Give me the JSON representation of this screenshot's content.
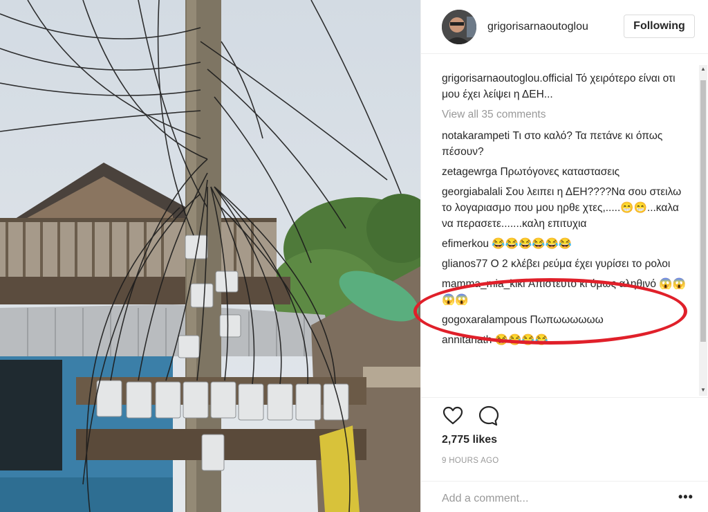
{
  "post": {
    "username": "grigorisarnaoutoglou",
    "follow_label": "Following",
    "view_all": "View all 35 comments",
    "likes": "2,775 likes",
    "time": "9 HOURS AGO",
    "add_comment_placeholder": "Add a comment...",
    "more_icon": "•••"
  },
  "comments": [
    {
      "user": "grigorisarnaoutoglou.official",
      "text": "Τό χειρότερο είναι οτι μου έχει λείψει η ΔΕΗ..."
    },
    {
      "user": "notakarampeti",
      "text": "Τι στο καλό? Τα πετάνε κι όπως πέσουν?"
    },
    {
      "user": "zetagewrga",
      "text": "Πρωτόγονες καταστασεις"
    },
    {
      "user": "georgiabalali",
      "text": "Σου λειπει η ΔΕΗ????Να σου στειλω το λογαριασμο που μου ηρθε χτες,.....😁😁...καλα να περασετε.......καλη επιτυχια"
    },
    {
      "user": "efimerkou",
      "text": "😂😂😂😂😂😂"
    },
    {
      "user": "glianos77",
      "text": "Ο 2 κλέβει ρεύμα έχει γυρίσει το ρολοι"
    },
    {
      "user": "mamma_mia_kiki",
      "text": "Απίστευτο κι όμως αληθινό 😱😱😱😱"
    },
    {
      "user": "gogoxaralampous",
      "text": "Πωπωωωωωω"
    },
    {
      "user": "annitanath",
      "text": "😂😂😂😂"
    }
  ],
  "colors": {
    "highlight": "#e0202a",
    "muted": "#999999",
    "text": "#262626"
  }
}
